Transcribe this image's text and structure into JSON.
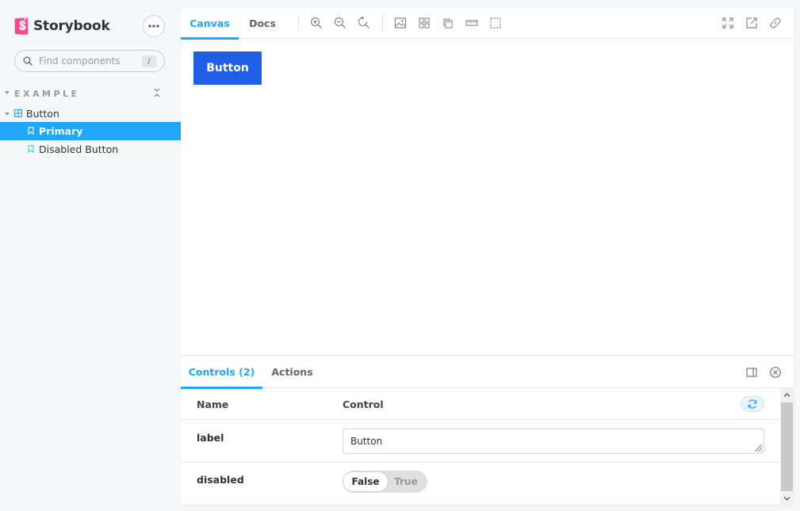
{
  "sidebar": {
    "brand": "Storybook",
    "search": {
      "placeholder": "Find components",
      "shortcut": "/"
    },
    "group": "EXAMPLE",
    "component": "Button",
    "stories": [
      "Primary",
      "Disabled Button"
    ]
  },
  "toolbar": {
    "tabs": [
      "Canvas",
      "Docs"
    ],
    "active_tab": "Canvas"
  },
  "canvas": {
    "button_label": "Button"
  },
  "addons": {
    "tabs": [
      "Controls (2)",
      "Actions"
    ],
    "active_tab": "Controls (2)",
    "columns": {
      "name": "Name",
      "control": "Control"
    },
    "rows": [
      {
        "name": "label",
        "value": "Button"
      },
      {
        "name": "disabled",
        "options": [
          "False",
          "True"
        ],
        "selected": "False"
      }
    ]
  },
  "colors": {
    "accent": "#1ea7fd",
    "brand_pink": "#ff4785",
    "story_button": "#1e5fe6",
    "sidebar_bg": "#f6f9fc"
  },
  "icons": {
    "toolbar": [
      "zoom-in-icon",
      "zoom-out-icon",
      "zoom-reset-icon",
      "background-icon",
      "grid-icon",
      "viewport-icon",
      "measure-icon",
      "outline-icon",
      "fullscreen-icon",
      "open-new-tab-icon",
      "copy-link-icon"
    ],
    "addons": [
      "panel-position-icon",
      "close-panel-icon"
    ]
  }
}
